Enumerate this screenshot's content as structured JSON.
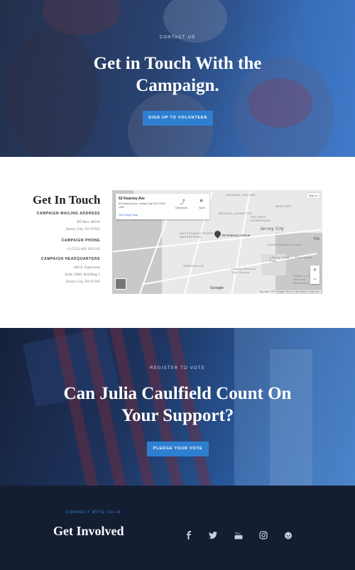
{
  "hero": {
    "eyebrow": "CONTACT US",
    "title_line1": "Get in Touch With the",
    "title_line2": "Campaign.",
    "button": "SIGN UP TO VOLUNTEER"
  },
  "contact": {
    "heading": "Get In Touch",
    "mailing_label": "CAMPAIGN MAILING ADDRESS",
    "mailing_line1": "PO Box 48516",
    "mailing_line2": "Jersey City, NJ 07305",
    "phone_label": "CAMPAIGN PHONE",
    "phone": "+1 (555) 482 1623 42",
    "hq_label": "CAMPAIGN HEADQUARTERS",
    "hq_line1": "408 E. Eastwood",
    "hq_line2": "Suite 3406, Building 5",
    "hq_line3": "Jersey City, NJ 07305"
  },
  "map": {
    "card_title": "62 Kearney Ave",
    "card_sub": "62 Kearney Ave, Jersey City, NJ 07305, USA",
    "directions": "Directions",
    "save": "Save",
    "view_larger": "View larger map",
    "sign_in": "Sign in",
    "pin_label": "62 Kearney Avenue",
    "place_jersey_city": "Jersey City",
    "place_downtown": "HISTORIC DOWNTOWN",
    "place_newport": "NEWPORT",
    "place_hackensack": "HACKENSACK RIVER WATERFRONT",
    "place_greenville": "GREENVILLE",
    "place_journal": "JOURNAL SQUARE",
    "place_bergen": "BERGEN-LAFAYETTE",
    "place_science": "Liberty Science Center",
    "place_liberty_park": "Liberty State Park",
    "place_liberty_monument": "Liberty National Golf Course",
    "place_ellis": "Ellis Island",
    "place_statue": "Statue of Liberty National Monument",
    "place_ne": "Ne",
    "google": "Google",
    "footer": "Map data ©2019 Google   Terms of Use   Report a map error",
    "zoom_in": "+",
    "zoom_out": "−"
  },
  "register": {
    "eyebrow": "REGISTER TO VOTE",
    "title_line1": "Can Julia Caulfield Count On",
    "title_line2": "Your Support?",
    "button": "PLEDGE YOUR VOTE"
  },
  "footer": {
    "eyebrow": "CONNECT WITH JULIA",
    "title": "Get Involved",
    "social": [
      "facebook-icon",
      "twitter-icon",
      "youtube-icon",
      "instagram-icon",
      "reddit-icon"
    ]
  },
  "colors": {
    "accent": "#2f7fd0",
    "footer_bg": "#141e33",
    "eyebrow_blue": "#3a88d8"
  }
}
